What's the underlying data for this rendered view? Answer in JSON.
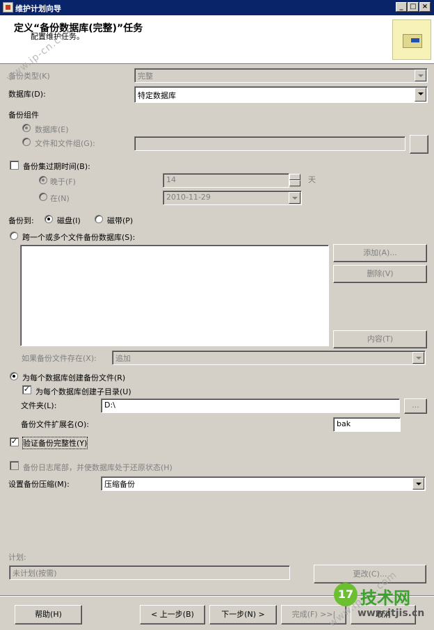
{
  "window": {
    "title": "维护计划向导",
    "minimize": "_",
    "maximize": "□",
    "close": "×"
  },
  "header": {
    "title": "定义“备份数据库(完整)”任务",
    "subtitle": "配置维护任务。"
  },
  "backup_type": {
    "label": "备份类型(K)",
    "value": "完整"
  },
  "database": {
    "label": "数据库(D):",
    "value": "特定数据库"
  },
  "backup_component": {
    "group_label": "备份组件",
    "database_option": "数据库(E)",
    "files_option": "文件和文件组(G):",
    "files_value": ""
  },
  "expiration": {
    "checkbox_label": "备份集过期时间(B):",
    "after_label": "晚于(F)",
    "after_value": "14",
    "after_unit": "天",
    "on_label": "在(N)",
    "on_value": "2010-11-29"
  },
  "backup_to": {
    "label": "备份到:",
    "disk": "磁盘(I)",
    "tape": "磁带(P)"
  },
  "span_files": {
    "label": "跨一个或多个文件备份数据库(S):",
    "add_button": "添加(A)...",
    "remove_button": "删除(V)",
    "contents_button": "内容(T)",
    "if_exists_label": "如果备份文件存在(X):",
    "if_exists_value": "追加"
  },
  "per_db_file": {
    "label": "为每个数据库创建备份文件(R)",
    "subdir_label": "为每个数据库创建子目录(U)",
    "folder_label": "文件夹(L):",
    "folder_value": "D:\\",
    "browse_button": "...",
    "ext_label": "备份文件扩展名(O):",
    "ext_value": "bak"
  },
  "verify": {
    "label": "验证备份完整性(Y)"
  },
  "tail_log": {
    "label": "备份日志尾部，并使数据库处于还原状态(H)"
  },
  "compression": {
    "label": "设置备份压缩(M):",
    "value": "压缩备份"
  },
  "schedule": {
    "label": "计划:",
    "value": "未计划(按需)",
    "change_button": "更改(C)..."
  },
  "footer": {
    "help": "帮助(H)",
    "back": "< 上一步(B)",
    "next": "下一步(N) >",
    "finish": "完成(F) >>|",
    "cancel": "取消"
  },
  "watermarks": {
    "top": "www.ip-cn.com",
    "bottom": "www.ip-cn.com"
  },
  "brand": {
    "icon": "17",
    "name": "技术网",
    "url": "www.itjis.cn"
  }
}
